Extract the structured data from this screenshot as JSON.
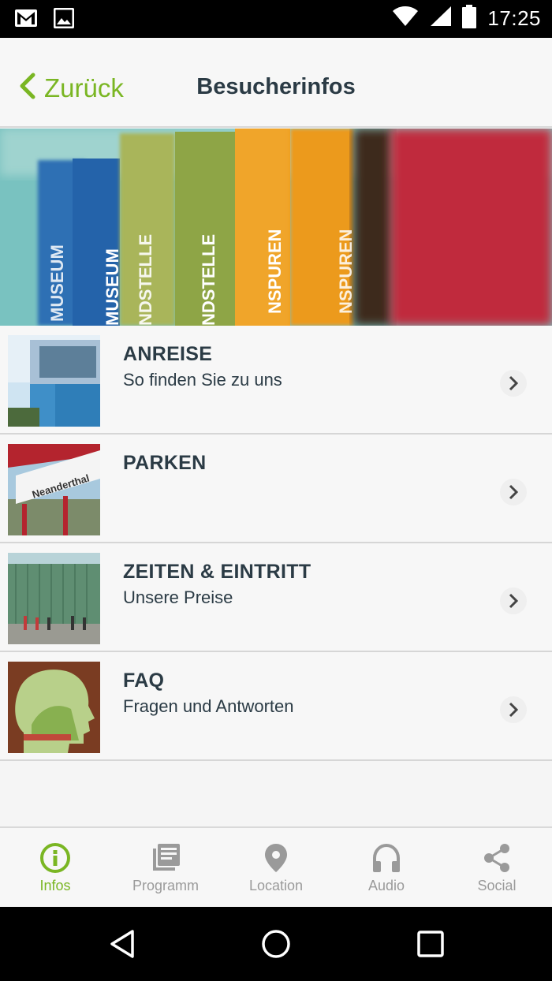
{
  "status_bar": {
    "time": "17:25",
    "icons": [
      "gmail-icon",
      "gallery-icon",
      "wifi-icon",
      "cellular-icon",
      "battery-icon"
    ]
  },
  "header": {
    "back_label": "Zurück",
    "title": "Besucherinfos"
  },
  "hero": {
    "spine_words": [
      "MUSEUM",
      "MUSEUM",
      "NDSTELLE",
      "NDSTELLE",
      "NSPUREN",
      "NSPUREN"
    ]
  },
  "list": {
    "items": [
      {
        "title": "ANREISE",
        "subtitle": "So finden Sie zu uns",
        "thumb": "building-photo"
      },
      {
        "title": "PARKEN",
        "subtitle": "",
        "thumb": "station-sign-photo",
        "thumb_text": "Neanderthal"
      },
      {
        "title": "ZEITEN & EINTRITT",
        "subtitle": "Unsere Preise",
        "thumb": "museum-entrance-photo"
      },
      {
        "title": "FAQ",
        "subtitle": "Fragen und Antworten",
        "thumb": "head-silhouette-photo"
      }
    ]
  },
  "tabs": [
    {
      "label": "Infos",
      "icon": "info-icon",
      "active": true
    },
    {
      "label": "Programm",
      "icon": "programm-icon",
      "active": false
    },
    {
      "label": "Location",
      "icon": "location-pin-icon",
      "active": false
    },
    {
      "label": "Audio",
      "icon": "headphones-icon",
      "active": false
    },
    {
      "label": "Social",
      "icon": "share-icon",
      "active": false
    }
  ],
  "colors": {
    "accent": "#7ab623",
    "text_dark": "#2b3b45",
    "tab_inactive": "#9a9a9a"
  }
}
